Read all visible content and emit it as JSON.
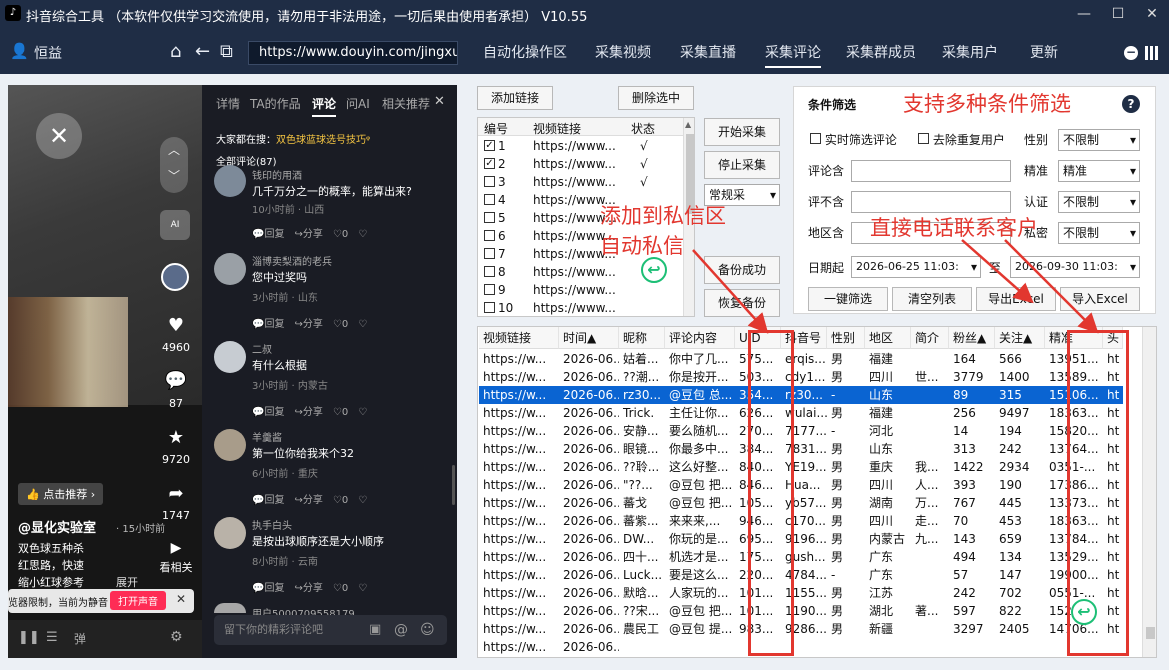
{
  "window": {
    "title": "抖音综合工具 （本软件仅供学习交流使用，请勿用于非法用途，一切后果由使用者承担）  V10.55",
    "logo": "tiktok-logo",
    "min": "—",
    "max": "☐",
    "close": "✕"
  },
  "nav": {
    "user": "恒益",
    "url": "https://www.douyin.com/jingxuan",
    "tabs": [
      "自动化操作区",
      "采集视频",
      "采集直播",
      "采集评论",
      "采集群成员",
      "采集用户",
      "更新"
    ],
    "active_tab": "采集评论"
  },
  "video": {
    "likes": "4960",
    "comments": "87",
    "favorites": "9720",
    "shares": "1747",
    "related": "看相关",
    "author": "@显化实验室",
    "time": "· 15小时前",
    "desc1": "双色球五种杀",
    "desc2": "红思路，快速",
    "desc3": "缩小红球参考",
    "expand": "展开",
    "promote": "点击推荐 ›",
    "mute_notice": "览器限制，当前为静音",
    "unmute": "打开声音",
    "ai": "AI",
    "danmu": "弹"
  },
  "comments_panel": {
    "tabs": [
      "详情",
      "TA的作品",
      "评论",
      "问AI",
      "相关推荐"
    ],
    "active": "评论",
    "search_hint": "大家都在搜：",
    "search_term": "双色球蓝球选号技巧",
    "count": "全部评论(87)",
    "items": [
      {
        "name": "钱印的用酒",
        "text": "几千万分之一的概率，能算出来?",
        "time": "10小时前 · 山西"
      },
      {
        "name": "淄博卖梨酒的老兵",
        "text": "您中过奖吗",
        "time": "3小时前 · 山东"
      },
      {
        "name": "二叔",
        "text": "有什么根据",
        "time": "3小时前 · 内蒙古"
      },
      {
        "name": "羊羹酱",
        "text": "第一位你给我来个32",
        "time": "6小时前 · 重庆"
      },
      {
        "name": "执手白头",
        "text": "是按出球顺序还是大小顺序",
        "time": "8小时前 · 云南"
      }
    ],
    "actions": {
      "reply": "回复",
      "share": "分享",
      "like": "0"
    },
    "last_name": "用户5000709558179",
    "input_placeholder": "留下你的精彩评论吧"
  },
  "links": {
    "add": "添加链接",
    "delete": "删除选中",
    "headers": [
      "编号",
      "视频链接",
      "状态"
    ],
    "rows": [
      {
        "n": "1",
        "url": "https://www...",
        "status": "√",
        "checked": true
      },
      {
        "n": "2",
        "url": "https://www...",
        "status": "√",
        "checked": true
      },
      {
        "n": "3",
        "url": "https://www...",
        "status": "√",
        "checked": false
      },
      {
        "n": "4",
        "url": "https://www...",
        "status": "",
        "checked": false
      },
      {
        "n": "5",
        "url": "https://www...",
        "status": "",
        "checked": false
      },
      {
        "n": "6",
        "url": "https://www...",
        "status": "",
        "checked": false
      },
      {
        "n": "7",
        "url": "https://www...",
        "status": "",
        "checked": false
      },
      {
        "n": "8",
        "url": "https://www...",
        "status": "",
        "checked": false
      },
      {
        "n": "9",
        "url": "https://www...",
        "status": "",
        "checked": false
      },
      {
        "n": "10",
        "url": "https://www...",
        "status": "",
        "checked": false
      }
    ]
  },
  "controls": {
    "start": "开始采集",
    "stop": "停止采集",
    "mode": "常规采",
    "backup": "备份成功",
    "restore": "恢复备份"
  },
  "filter": {
    "title": "条件筛选",
    "realtime": "实时筛选评论",
    "dedupe": "去除重复用户",
    "gender_label": "性别",
    "gender": "不限制",
    "contains_label": "评论含",
    "precise_label": "精准",
    "precise": "精准",
    "excludes_label": "评不含",
    "verify_label": "认证",
    "verify": "不限制",
    "region_label": "地区含",
    "follow_label": "私密",
    "follow": "不限制",
    "date_label": "日期起",
    "date_from": "2026-06-25 11:03:",
    "date_to_label": "至",
    "date_to": "2026-09-30 11:03:",
    "btn_filter": "一键筛选",
    "btn_clear": "清空列表",
    "btn_export": "导出Excel",
    "btn_import": "导入Excel"
  },
  "overlay": {
    "filter_text": "支持多种条件筛选",
    "private_line1": "添加到私信区",
    "private_line2": "自动私信",
    "phone_text": "直接电话联系客户",
    "arrow": "↩"
  },
  "grid": {
    "headers": [
      "视频链接",
      "时间▲",
      "昵称",
      "评论内容",
      "UID",
      "抖音号",
      "性别",
      "地区",
      "简介",
      "粉丝▲",
      "关注▲",
      "精准",
      "头"
    ],
    "rows": [
      [
        "https://w...",
        "2026-06...",
        "姑着...",
        "你中了几...",
        "575...",
        "erqis...",
        "男",
        "福建",
        "",
        "164",
        "566",
        "13951...",
        "ht"
      ],
      [
        "https://w...",
        "2026-06...",
        "??潮...",
        "你是按开...",
        "503...",
        "cdy1...",
        "男",
        "四川",
        "世...",
        "3779",
        "1400",
        "13589...",
        "ht"
      ],
      [
        "https://w...",
        "2026-06...",
        "rz30...",
        "@豆包 总...",
        "354...",
        "rz30...",
        "-",
        "山东",
        "",
        "89",
        "315",
        "15106...",
        "ht"
      ],
      [
        "https://w...",
        "2026-06...",
        "Trick.",
        "主任让你...",
        "626...",
        "wulai...",
        "男",
        "福建",
        "",
        "256",
        "9497",
        "18363...",
        "ht"
      ],
      [
        "https://w...",
        "2026-06...",
        "安静...",
        "要么随机...",
        "270...",
        "7177...",
        "-",
        "河北",
        "",
        "14",
        "194",
        "15820...",
        "ht"
      ],
      [
        "https://w...",
        "2026-06...",
        "眼镜...",
        "你最多中...",
        "384...",
        "7831...",
        "男",
        "山东",
        "",
        "313",
        "242",
        "13764...",
        "ht"
      ],
      [
        "https://w...",
        "2026-06...",
        "??聆...",
        "这么好整...",
        "840...",
        "YE19...",
        "男",
        "重庆",
        "我...",
        "1422",
        "2934",
        "0351-...",
        "ht"
      ],
      [
        "https://w...",
        "2026-06...",
        "\"??...",
        "@豆包 把...",
        "846...",
        "Hua...",
        "男",
        "四川",
        "人...",
        "393",
        "190",
        "17386...",
        "ht"
      ],
      [
        "https://w...",
        "2026-06...",
        "蕃戈",
        "@豆包 把...",
        "105...",
        "yb57...",
        "男",
        "湖南",
        "万...",
        "767",
        "445",
        "13373...",
        "ht"
      ],
      [
        "https://w...",
        "2026-06...",
        "蕃紫...",
        "来来来,...",
        "946...",
        "c170...",
        "男",
        "四川",
        "走...",
        "70",
        "453",
        "18363...",
        "ht"
      ],
      [
        "https://w...",
        "2026-06...",
        "DW...",
        "你玩的是...",
        "695...",
        "9196...",
        "男",
        "内蒙古",
        "九...",
        "143",
        "659",
        "13784...",
        "ht"
      ],
      [
        "https://w...",
        "2026-06...",
        "四十...",
        "机选才是...",
        "175...",
        "gush...",
        "男",
        "广东",
        "",
        "494",
        "134",
        "13529...",
        "ht"
      ],
      [
        "https://w...",
        "2026-06...",
        "Luck...",
        "要是这么...",
        "220...",
        "4784...",
        "-",
        "广东",
        "",
        "57",
        "147",
        "19900...",
        "ht"
      ],
      [
        "https://w...",
        "2026-06...",
        "默晗...",
        "人家玩的...",
        "101...",
        "1155...",
        "男",
        "江苏",
        "",
        "242",
        "702",
        "0551-...",
        "ht"
      ],
      [
        "https://w...",
        "2026-06...",
        "??宋...",
        "@豆包 把...",
        "101...",
        "1190...",
        "男",
        "湖北",
        "著...",
        "597",
        "822",
        "1525...",
        "ht"
      ],
      [
        "https://w...",
        "2026-06...",
        "農民工",
        "@豆包 提...",
        "983...",
        "9286...",
        "男",
        "新疆",
        "",
        "3297",
        "2405",
        "14706...",
        "ht"
      ],
      [
        "https://w...",
        "2026-06...",
        "",
        "",
        "",
        "",
        "",
        "",
        "",
        "",
        "",
        "",
        ""
      ]
    ],
    "selected_row": 2
  }
}
